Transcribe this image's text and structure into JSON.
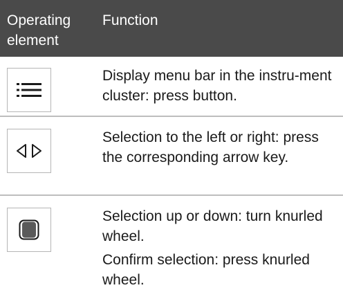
{
  "header": {
    "col1": "Operating element",
    "col2": "Function"
  },
  "rows": [
    {
      "icon": "menu-list-icon",
      "texts": [
        "Display menu bar in the instru-ment cluster: press button."
      ]
    },
    {
      "icon": "left-right-arrows-icon",
      "texts": [
        "Selection to the left or right: press the corresponding arrow key."
      ]
    },
    {
      "icon": "knurled-wheel-icon",
      "texts": [
        "Selection up or down: turn knurled wheel.",
        "Confirm selection: press knurled wheel."
      ]
    }
  ],
  "colors": {
    "header_bg": "#4a4a4a",
    "divider": "#bdbdbd",
    "icon_border": "#b5b5b5",
    "wheel_fill": "#5a5a5a"
  }
}
